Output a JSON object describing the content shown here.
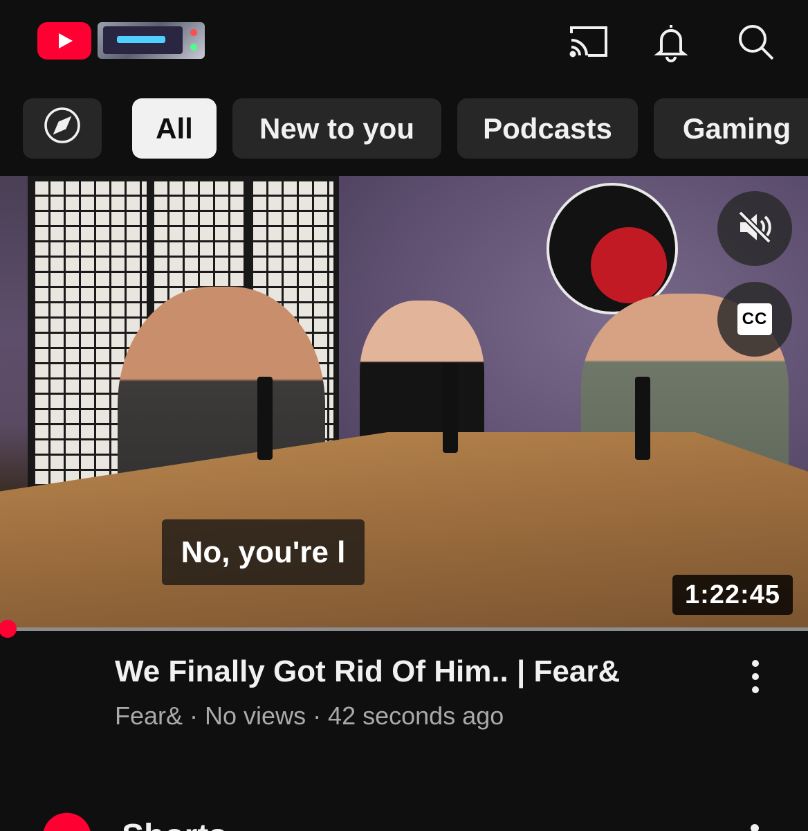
{
  "header": {
    "logo_icon": "youtube-logo-icon",
    "doodle_icon": "yoodle-retro-tv-icon",
    "actions": [
      "cast-icon",
      "bell-icon",
      "search-icon"
    ]
  },
  "chips": {
    "explore_icon": "compass-icon",
    "items": [
      {
        "label": "All",
        "active": true
      },
      {
        "label": "New to you",
        "active": false
      },
      {
        "label": "Podcasts",
        "active": false
      },
      {
        "label": "Gaming",
        "active": false
      }
    ]
  },
  "video": {
    "caption": "No, you're l",
    "duration": "1:22:45",
    "mute_icon": "muted-speaker-icon",
    "cc_label": "CC",
    "progress_fraction": 0.01,
    "title": "We Finally Got Rid Of Him.. | Fear&",
    "meta": "Fear& · No views · 42 seconds ago"
  },
  "shorts": {
    "title": "Shorts",
    "icon": "shorts-logo-icon"
  },
  "colors": {
    "background": "#0f0f0f",
    "chip_bg": "#272727",
    "chip_active_bg": "#f1f1f1",
    "brand_red": "#ff0033",
    "meta_text": "#aaaaaa"
  }
}
